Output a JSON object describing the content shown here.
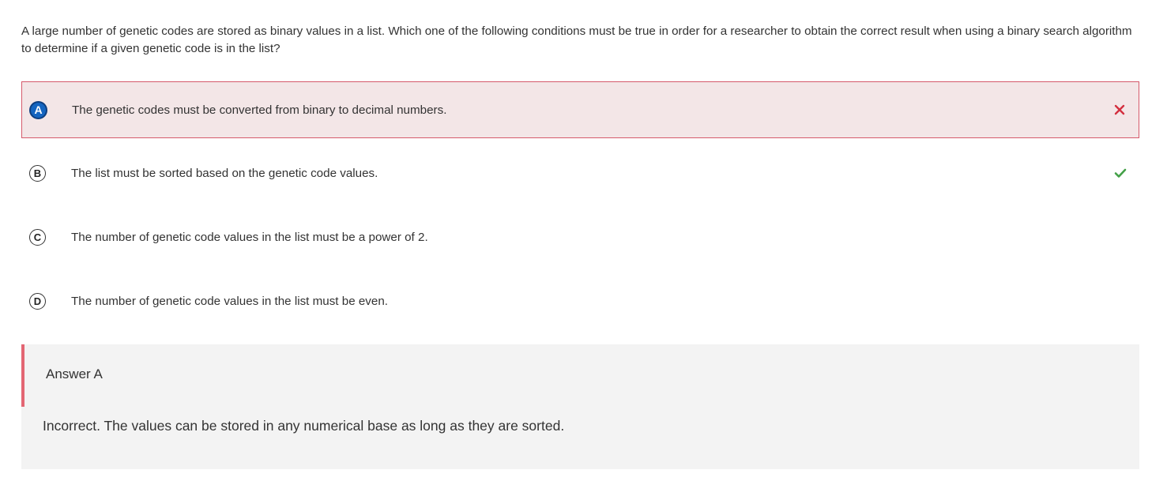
{
  "question": {
    "text": "A large number of genetic codes are stored as binary values in a list. Which one of the following conditions must be true in order for a researcher to obtain the correct result when using a binary search algorithm to determine if a given genetic code is in the list?"
  },
  "options": [
    {
      "letter": "A",
      "text": "The genetic codes must be converted from binary to decimal numbers.",
      "state": "selected-incorrect",
      "mark_icon": "x-icon"
    },
    {
      "letter": "B",
      "text": "The list must be sorted based on the genetic code values.",
      "state": "correct",
      "mark_icon": "check-icon"
    },
    {
      "letter": "C",
      "text": "The number of genetic code values in the list must be a power of 2.",
      "state": "none"
    },
    {
      "letter": "D",
      "text": "The number of genetic code values in the list must be even.",
      "state": "none"
    }
  ],
  "feedback": {
    "title": "Answer A",
    "body": "Incorrect. The values can be stored in any numerical base as long as they are sorted."
  },
  "colors": {
    "selected_bg": "#f3e6e7",
    "selected_border": "#d55a6b",
    "incorrect_mark": "#d32f3f",
    "correct_mark": "#43a047",
    "selected_badge": "#1565c0",
    "feedback_bg": "#f3f3f3",
    "feedback_bar": "#e36673"
  }
}
